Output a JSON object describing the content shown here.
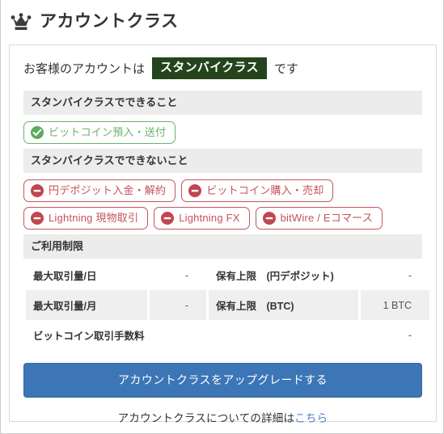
{
  "header": {
    "icon": "crown-icon",
    "title": "アカウントクラス"
  },
  "status": {
    "prefix": "お客様のアカウントは",
    "badge": "スタンバイクラス",
    "suffix": "です",
    "badge_color": "#24441c"
  },
  "allowed_section": {
    "title": "スタンバイクラスでできること",
    "color": "#6cb06c",
    "chips": [
      {
        "icon": "check-circle-icon",
        "label": "ビットコイン預入・送付"
      }
    ]
  },
  "denied_section": {
    "title": "スタンバイクラスでできないこと",
    "color": "#c4545a",
    "chips_row1": [
      {
        "icon": "minus-circle-icon",
        "label": "円デポジット入金・解約"
      },
      {
        "icon": "minus-circle-icon",
        "label": "ビットコイン購入・売却"
      }
    ],
    "chips_row2": [
      {
        "icon": "minus-circle-icon",
        "label": "Lightning 現物取引"
      },
      {
        "icon": "minus-circle-icon",
        "label": "Lightning FX"
      },
      {
        "icon": "minus-circle-icon",
        "label": "bitWire / Eコマース"
      }
    ]
  },
  "limits_section": {
    "title": "ご利用制限",
    "rows": [
      {
        "left_label": "最大取引量/日",
        "left_value": "-",
        "right_label": "保有上限　(円デポジット)",
        "right_value": "-"
      },
      {
        "left_label": "最大取引量/月",
        "left_value": "-",
        "right_label": "保有上限　(BTC)",
        "right_value": "1 BTC"
      }
    ],
    "full_row": {
      "label": "ビットコイン取引手数料",
      "value": "-"
    }
  },
  "footer": {
    "upgrade_button": "アカウントクラスをアップグレードする",
    "button_color": "#3c76b6",
    "detail_text": "アカウントクラスについての詳細は",
    "detail_link": "こちら",
    "link_color": "#4a86c8"
  }
}
